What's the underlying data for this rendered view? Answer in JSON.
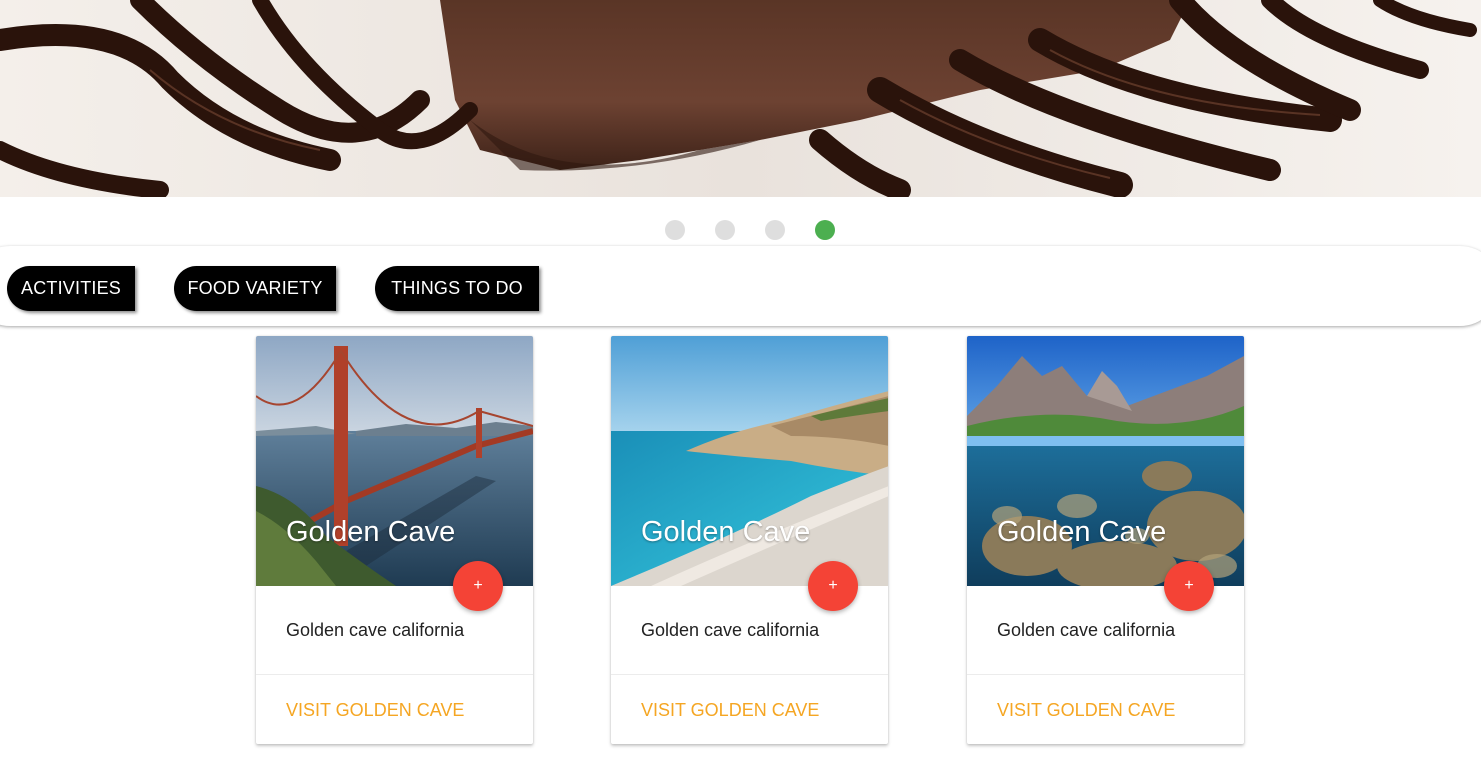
{
  "carousel": {
    "slides": [
      "slide-1",
      "slide-2",
      "slide-3",
      "slide-4"
    ],
    "active_index": 4,
    "active_color": "#4caf50",
    "inactive_color": "#dedede"
  },
  "tabs": [
    {
      "label": "ACTIVITIES"
    },
    {
      "label": "FOOD VARIETY"
    },
    {
      "label": "THINGS TO DO"
    }
  ],
  "cards": [
    {
      "image": "golden-gate-bridge-photo",
      "title": "Golden Cave",
      "fab_label": "+",
      "description": "Golden cave california",
      "link_label": "VISIT GOLDEN CAVE"
    },
    {
      "image": "beach-cove-photo",
      "title": "Golden Cave",
      "fab_label": "+",
      "description": "Golden cave california",
      "link_label": "VISIT GOLDEN CAVE"
    },
    {
      "image": "mountain-lake-photo",
      "title": "Golden Cave",
      "fab_label": "+",
      "description": "Golden cave california",
      "link_label": "VISIT GOLDEN CAVE"
    }
  ],
  "colors": {
    "fab": "#f44336",
    "link": "#f5a623",
    "tab_bg": "#000000"
  }
}
